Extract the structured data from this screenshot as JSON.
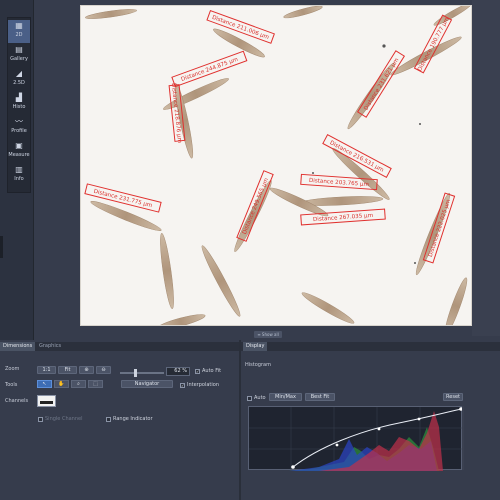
{
  "left_toolbar": {
    "items": [
      {
        "label": "2D",
        "icon": "grid-icon",
        "active": true
      },
      {
        "label": "Gallery",
        "icon": "gallery-icon",
        "active": false
      },
      {
        "label": "2.5D",
        "icon": "surface-icon",
        "active": false
      },
      {
        "label": "Histo",
        "icon": "histogram-icon",
        "active": false
      },
      {
        "label": "Profile",
        "icon": "profile-icon",
        "active": false
      },
      {
        "label": "Measure",
        "icon": "measure-icon",
        "active": false
      },
      {
        "label": "Info",
        "icon": "info-icon",
        "active": false
      }
    ]
  },
  "image": {
    "measurements": [
      "Distance 211.006 µm",
      "Distance 244.875 µm",
      "Distance 218.876 µm",
      "Distance 231.621 µm",
      "Distance 190.777 µm",
      "Distance 216.531 µm",
      "Distance 203.765 µm",
      "Distance 231.775 µm",
      "Distance 249.565 µm",
      "Distance 267.035 µm",
      "Distance 222.025 µm"
    ],
    "handle_label": "≡ Show all"
  },
  "dimensions_panel": {
    "tabs": [
      "Dimensions",
      "Graphics"
    ],
    "zoom_label": "Zoom",
    "zoom_buttons": [
      "1:1",
      "Fit",
      "⊕",
      "⊖"
    ],
    "zoom_value": "62 %",
    "auto_fit_label": "Auto Fit",
    "tools_label": "Tools",
    "navigator_label": "Navigator",
    "interpolation_label": "Interpolation",
    "channels_label": "Channels",
    "single_channel_label": "Single Channel",
    "range_indicator_label": "Range Indicator"
  },
  "display_panel": {
    "tab": "Display",
    "histogram_label": "Histogram",
    "auto_label": "Auto",
    "min_max_label": "Min/Max",
    "best_fit_label": "Best Fit",
    "reset_label": "Reset"
  },
  "colors": {
    "accent": "#3d6db5",
    "annotation": "#e0302e",
    "pollen": "#b39a80"
  }
}
